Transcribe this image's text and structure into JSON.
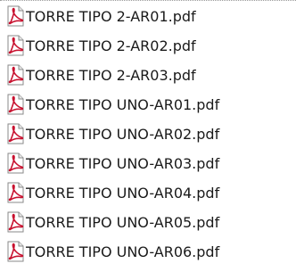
{
  "file_list": {
    "items": [
      {
        "name": "TORRE TIPO 2-AR01.pdf",
        "icon": "pdf-file-icon"
      },
      {
        "name": "TORRE TIPO 2-AR02.pdf",
        "icon": "pdf-file-icon"
      },
      {
        "name": "TORRE TIPO 2-AR03.pdf",
        "icon": "pdf-file-icon"
      },
      {
        "name": "TORRE TIPO UNO-AR01.pdf",
        "icon": "pdf-file-icon"
      },
      {
        "name": "TORRE TIPO UNO-AR02.pdf",
        "icon": "pdf-file-icon"
      },
      {
        "name": "TORRE TIPO UNO-AR03.pdf",
        "icon": "pdf-file-icon"
      },
      {
        "name": "TORRE TIPO UNO-AR04.pdf",
        "icon": "pdf-file-icon"
      },
      {
        "name": "TORRE TIPO UNO-AR05.pdf",
        "icon": "pdf-file-icon"
      },
      {
        "name": "TORRE TIPO UNO-AR06.pdf",
        "icon": "pdf-file-icon"
      }
    ]
  },
  "colors": {
    "pdf_icon_red": "#c8102e",
    "text": "#1a1a1a"
  }
}
